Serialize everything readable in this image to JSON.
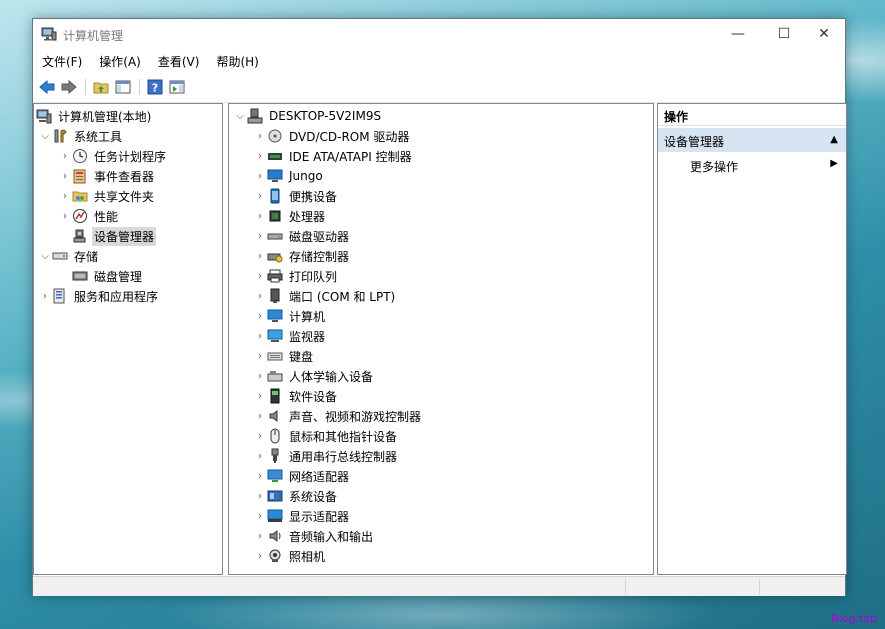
{
  "window": {
    "title": "计算机管理"
  },
  "window_controls": {
    "minimize": "—",
    "maximize": "☐",
    "close": "✕"
  },
  "menu": [
    "文件(F)",
    "操作(A)",
    "查看(V)",
    "帮助(H)"
  ],
  "left_tree": [
    {
      "label": "计算机管理(本地)",
      "icon": "computer-manage-icon",
      "arrow": "",
      "level": 0
    },
    {
      "label": "系统工具",
      "icon": "tools-icon",
      "arrow": "expanded",
      "level": 1
    },
    {
      "label": "任务计划程序",
      "icon": "clock-icon",
      "arrow": "collapsed",
      "level": 2
    },
    {
      "label": "事件查看器",
      "icon": "event-viewer-icon",
      "arrow": "collapsed",
      "level": 2
    },
    {
      "label": "共享文件夹",
      "icon": "shared-folder-icon",
      "arrow": "collapsed",
      "level": 2
    },
    {
      "label": "性能",
      "icon": "performance-icon",
      "arrow": "collapsed",
      "level": 2
    },
    {
      "label": "设备管理器",
      "icon": "device-manager-icon",
      "arrow": "",
      "level": 2,
      "selected": true
    },
    {
      "label": "存储",
      "icon": "storage-icon",
      "arrow": "expanded",
      "level": 1
    },
    {
      "label": "磁盘管理",
      "icon": "disk-management-icon",
      "arrow": "",
      "level": 2
    },
    {
      "label": "服务和应用程序",
      "icon": "services-icon",
      "arrow": "collapsed",
      "level": 1
    }
  ],
  "device_tree": {
    "root": "DESKTOP-5V2IM9S",
    "items": [
      {
        "label": "DVD/CD-ROM 驱动器",
        "icon": "dvd-icon"
      },
      {
        "label": "IDE ATA/ATAPI 控制器",
        "icon": "ide-controller-icon"
      },
      {
        "label": "Jungo",
        "icon": "jungo-icon"
      },
      {
        "label": "便携设备",
        "icon": "portable-device-icon"
      },
      {
        "label": "处理器",
        "icon": "processor-icon"
      },
      {
        "label": "磁盘驱动器",
        "icon": "disk-drive-icon"
      },
      {
        "label": "存储控制器",
        "icon": "storage-controller-icon"
      },
      {
        "label": "打印队列",
        "icon": "printer-icon"
      },
      {
        "label": "端口 (COM 和 LPT)",
        "icon": "port-icon"
      },
      {
        "label": "计算机",
        "icon": "computer-icon"
      },
      {
        "label": "监视器",
        "icon": "monitor-icon"
      },
      {
        "label": "键盘",
        "icon": "keyboard-icon"
      },
      {
        "label": "人体学输入设备",
        "icon": "hid-icon"
      },
      {
        "label": "软件设备",
        "icon": "software-device-icon"
      },
      {
        "label": "声音、视频和游戏控制器",
        "icon": "speaker-icon"
      },
      {
        "label": "鼠标和其他指针设备",
        "icon": "mouse-icon"
      },
      {
        "label": "通用串行总线控制器",
        "icon": "usb-icon"
      },
      {
        "label": "网络适配器",
        "icon": "network-adapter-icon"
      },
      {
        "label": "系统设备",
        "icon": "system-device-icon"
      },
      {
        "label": "显示适配器",
        "icon": "display-adapter-icon"
      },
      {
        "label": "音频输入和输出",
        "icon": "audio-io-icon"
      },
      {
        "label": "照相机",
        "icon": "camera-icon"
      }
    ]
  },
  "actions": {
    "header": "操作",
    "section": "设备管理器",
    "items": [
      "更多操作"
    ]
  },
  "watermark": "Blog.top"
}
